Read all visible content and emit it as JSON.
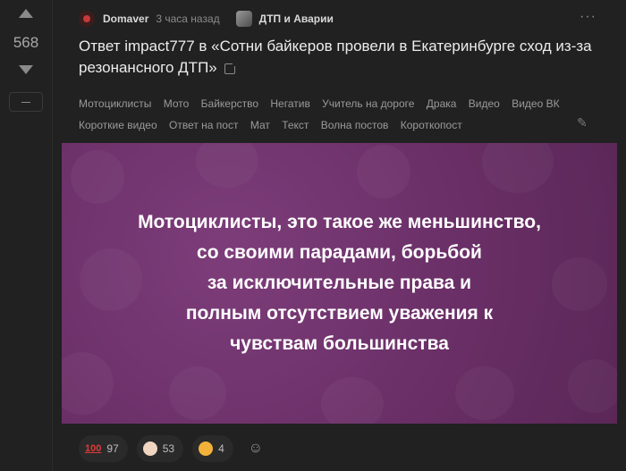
{
  "votes": {
    "count": "568"
  },
  "post": {
    "author": "Domaver",
    "time": "3 часа назад",
    "community": "ДТП и Аварии",
    "more_icon": "more-icon",
    "title": "Ответ impact777 в «Сотни байкеров провели в Екатеринбурге сход из-за резонансного ДТП»"
  },
  "tags": [
    "Мотоциклисты",
    "Мото",
    "Байкерство",
    "Негатив",
    "Учитель на дороге",
    "Драка",
    "Видео",
    "Видео ВК",
    "Короткие видео",
    "Ответ на пост",
    "Мат",
    "Текст",
    "Волна постов",
    "Короткопост"
  ],
  "image": {
    "lines": [
      "Мотоциклисты, это такое же меньшинство,",
      "со своими парадами, борьбой",
      "за исключительные права и",
      "полным отсутствием уважения к",
      "чувствам большинства"
    ],
    "background_color": "#6a2f67"
  },
  "reactions": [
    {
      "emoji": "hundred-points-icon",
      "count": "97"
    },
    {
      "emoji": "clown-face-icon",
      "count": "53"
    },
    {
      "emoji": "cowboy-face-icon",
      "count": "4"
    }
  ]
}
